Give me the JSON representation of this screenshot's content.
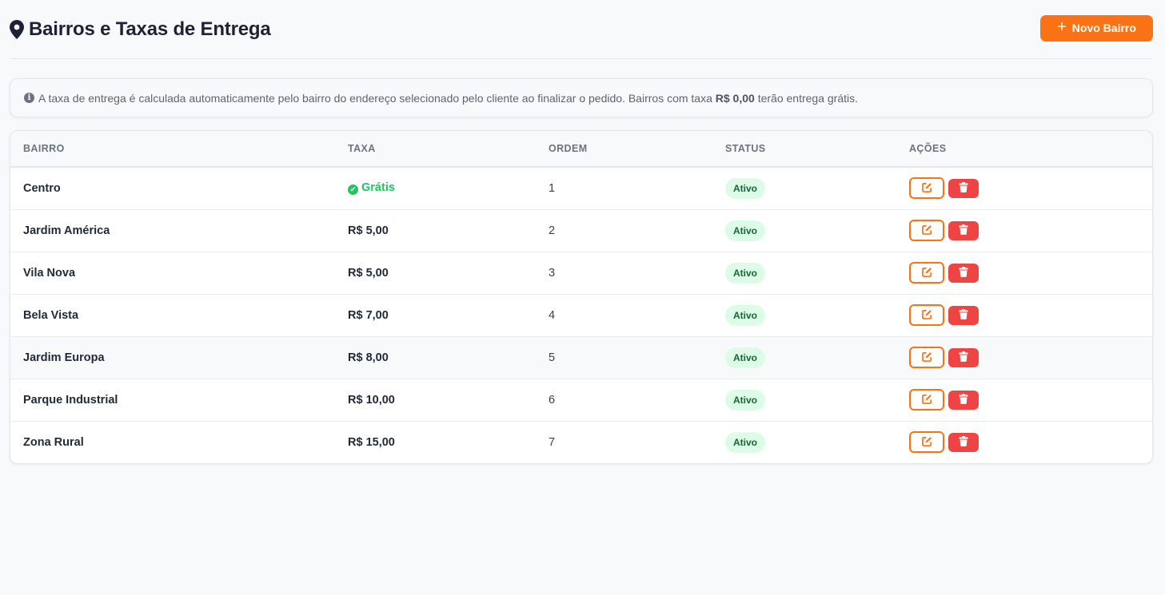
{
  "header": {
    "title": "Bairros e Taxas de Entrega",
    "icon": "map-pin-icon",
    "new_button": "Novo Bairro"
  },
  "info": {
    "text_before": "A taxa de entrega é calculada automaticamente pelo bairro do endereço selecionado pelo cliente ao finalizar o pedido. Bairros com taxa",
    "highlight": "R$ 0,00",
    "text_after": "terão entrega grátis."
  },
  "table": {
    "columns": [
      "BAIRRO",
      "TAXA",
      "ORDEM",
      "STATUS",
      "AÇÕES"
    ],
    "rows": [
      {
        "bairro": "Centro",
        "taxa": "Grátis",
        "free": true,
        "ordem": "1",
        "status": "Ativo"
      },
      {
        "bairro": "Jardim América",
        "taxa": "R$ 5,00",
        "free": false,
        "ordem": "2",
        "status": "Ativo"
      },
      {
        "bairro": "Vila Nova",
        "taxa": "R$ 5,00",
        "free": false,
        "ordem": "3",
        "status": "Ativo"
      },
      {
        "bairro": "Bela Vista",
        "taxa": "R$ 7,00",
        "free": false,
        "ordem": "4",
        "status": "Ativo"
      },
      {
        "bairro": "Jardim Europa",
        "taxa": "R$ 8,00",
        "free": false,
        "ordem": "5",
        "status": "Ativo"
      },
      {
        "bairro": "Parque Industrial",
        "taxa": "R$ 10,00",
        "free": false,
        "ordem": "6",
        "status": "Ativo"
      },
      {
        "bairro": "Zona Rural",
        "taxa": "R$ 15,00",
        "free": false,
        "ordem": "7",
        "status": "Ativo"
      }
    ]
  },
  "colors": {
    "accent": "#f97316",
    "danger": "#ef4444",
    "success": "#22c55e",
    "badge_bg": "#dcfce7",
    "badge_text": "#166534"
  }
}
